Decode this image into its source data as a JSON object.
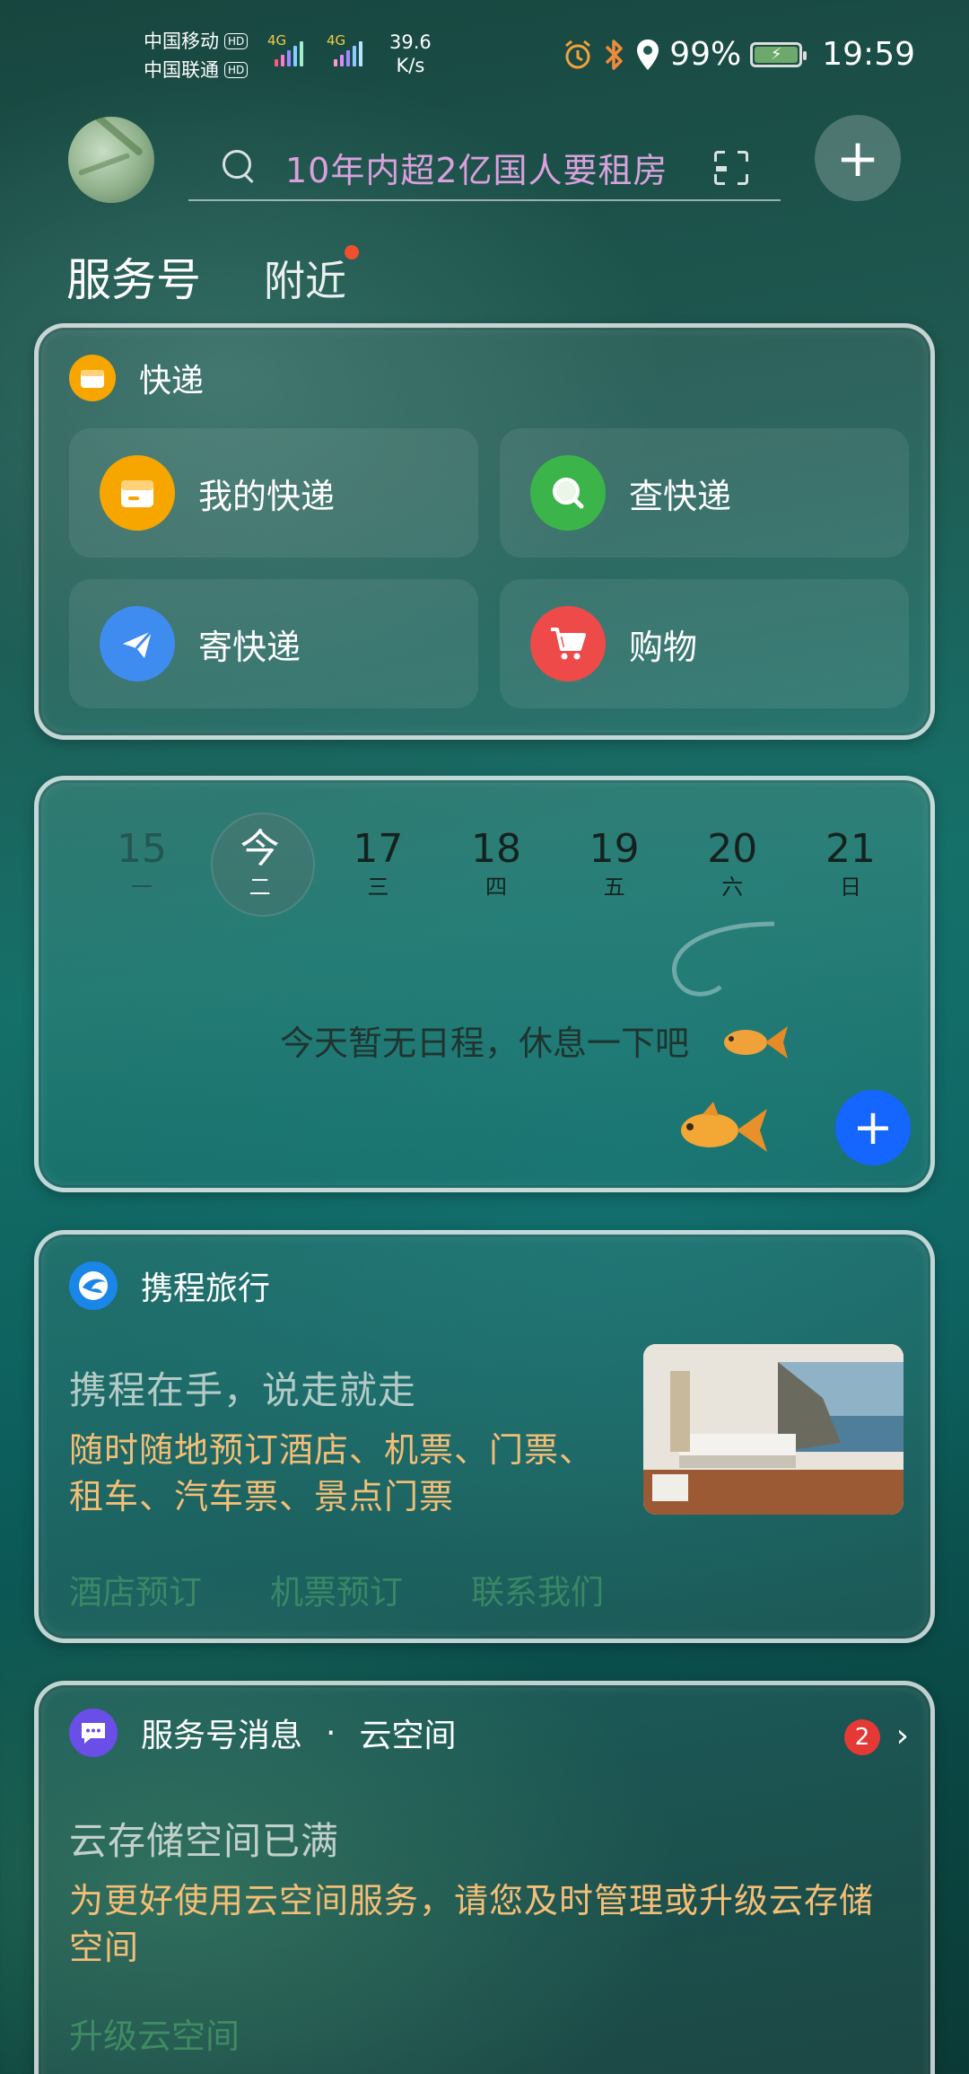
{
  "status_bar": {
    "carrier_1": "中国移动",
    "carrier_2": "中国联通",
    "hd_label": "HD",
    "network_1": "4G",
    "network_2": "4G",
    "speed_value": "39.6",
    "speed_unit": "K/s",
    "battery_percent": "99%",
    "time": "19:59",
    "icons": [
      "alarm-icon",
      "bluetooth-icon",
      "location-icon",
      "battery-charging-icon"
    ]
  },
  "header": {
    "search_placeholder": "10年内超2亿国人要租房"
  },
  "tabs": [
    {
      "label": "服务号",
      "active": true
    },
    {
      "label": "附近",
      "active": false,
      "has_dot": true
    }
  ],
  "express_card": {
    "title": "快递",
    "tiles": [
      {
        "label": "我的快递",
        "icon": "package-icon",
        "color": "#f7a600"
      },
      {
        "label": "查快递",
        "icon": "search-icon",
        "color": "#3bb54a"
      },
      {
        "label": "寄快递",
        "icon": "send-icon",
        "color": "#3f8cf0"
      },
      {
        "label": "购物",
        "icon": "shopping-cart-icon",
        "color": "#ee4a4a"
      }
    ]
  },
  "calendar_card": {
    "days": [
      {
        "num": "15",
        "weekday": "一"
      },
      {
        "num": "今",
        "weekday": "二",
        "today": true
      },
      {
        "num": "17",
        "weekday": "三"
      },
      {
        "num": "18",
        "weekday": "四"
      },
      {
        "num": "19",
        "weekday": "五"
      },
      {
        "num": "20",
        "weekday": "六"
      },
      {
        "num": "21",
        "weekday": "日"
      }
    ],
    "empty_text": "今天暂无日程，休息一下吧"
  },
  "ctrip_card": {
    "title": "携程旅行",
    "promo_title": "携程在手，说走就走",
    "promo_desc": "随时随地预订酒店、机票、门票、租车、汽车票、景点门票",
    "links": [
      "酒店预订",
      "机票预订",
      "联系我们"
    ]
  },
  "message_card": {
    "title": "服务号消息",
    "separator": "·",
    "source": "云空间",
    "badge_count": "2",
    "msg_title": "云存储空间已满",
    "msg_desc": "为更好使用云空间服务，请您及时管理或升级云存储空间",
    "action": "升级云空间"
  },
  "colors": {
    "accent_blue": "#1565ff",
    "search_text": "#d9a1dc",
    "promo_text": "#f5be76",
    "badge_red": "#e53935"
  }
}
